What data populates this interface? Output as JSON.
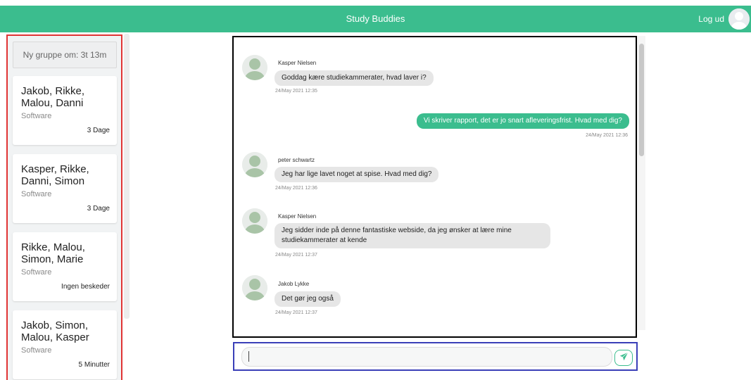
{
  "header": {
    "title": "Study Buddies",
    "logout_label": "Log ud",
    "brand_color": "#3bbd8e"
  },
  "sidebar": {
    "new_group_label": "Ny gruppe om: 3t 13m",
    "groups": [
      {
        "names": "Jakob, Rikke, Malou, Danni",
        "topic": "Software",
        "time": "3 Dage"
      },
      {
        "names": "Kasper, Rikke, Danni, Simon",
        "topic": "Software",
        "time": "3 Dage"
      },
      {
        "names": "Rikke, Malou, Simon, Marie",
        "topic": "Software",
        "time": "Ingen beskeder"
      },
      {
        "names": "Jakob, Simon, Malou, Kasper",
        "topic": "Software",
        "time": "5 Minutter"
      }
    ]
  },
  "chat": {
    "messages": [
      {
        "author": "Kasper Nielsen",
        "text": "Goddag kære studiekammerater, hvad laver i?",
        "time": "24/May 2021 12:35",
        "own": false
      },
      {
        "author": "",
        "text": "Vi skriver rapport, det er jo snart afleveringsfrist. Hvad med dig?",
        "time": "24/May 2021 12:36",
        "own": true
      },
      {
        "author": "peter schwartz",
        "text": "Jeg har lige lavet noget at spise. Hvad med dig?",
        "time": "24/May 2021 12:36",
        "own": false
      },
      {
        "author": "Kasper Nielsen",
        "text": "Jeg sidder inde på denne fantastiske webside, da jeg ønsker at lære mine studiekammerater at kende",
        "time": "24/May 2021 12:37",
        "own": false
      },
      {
        "author": "Jakob Lykke",
        "text": "Det gør jeg også",
        "time": "24/May 2021 12:37",
        "own": false
      }
    ]
  },
  "composer": {
    "value": "",
    "placeholder": ""
  },
  "icons": {
    "avatar": "user-avatar-icon",
    "send": "paper-plane-icon"
  }
}
